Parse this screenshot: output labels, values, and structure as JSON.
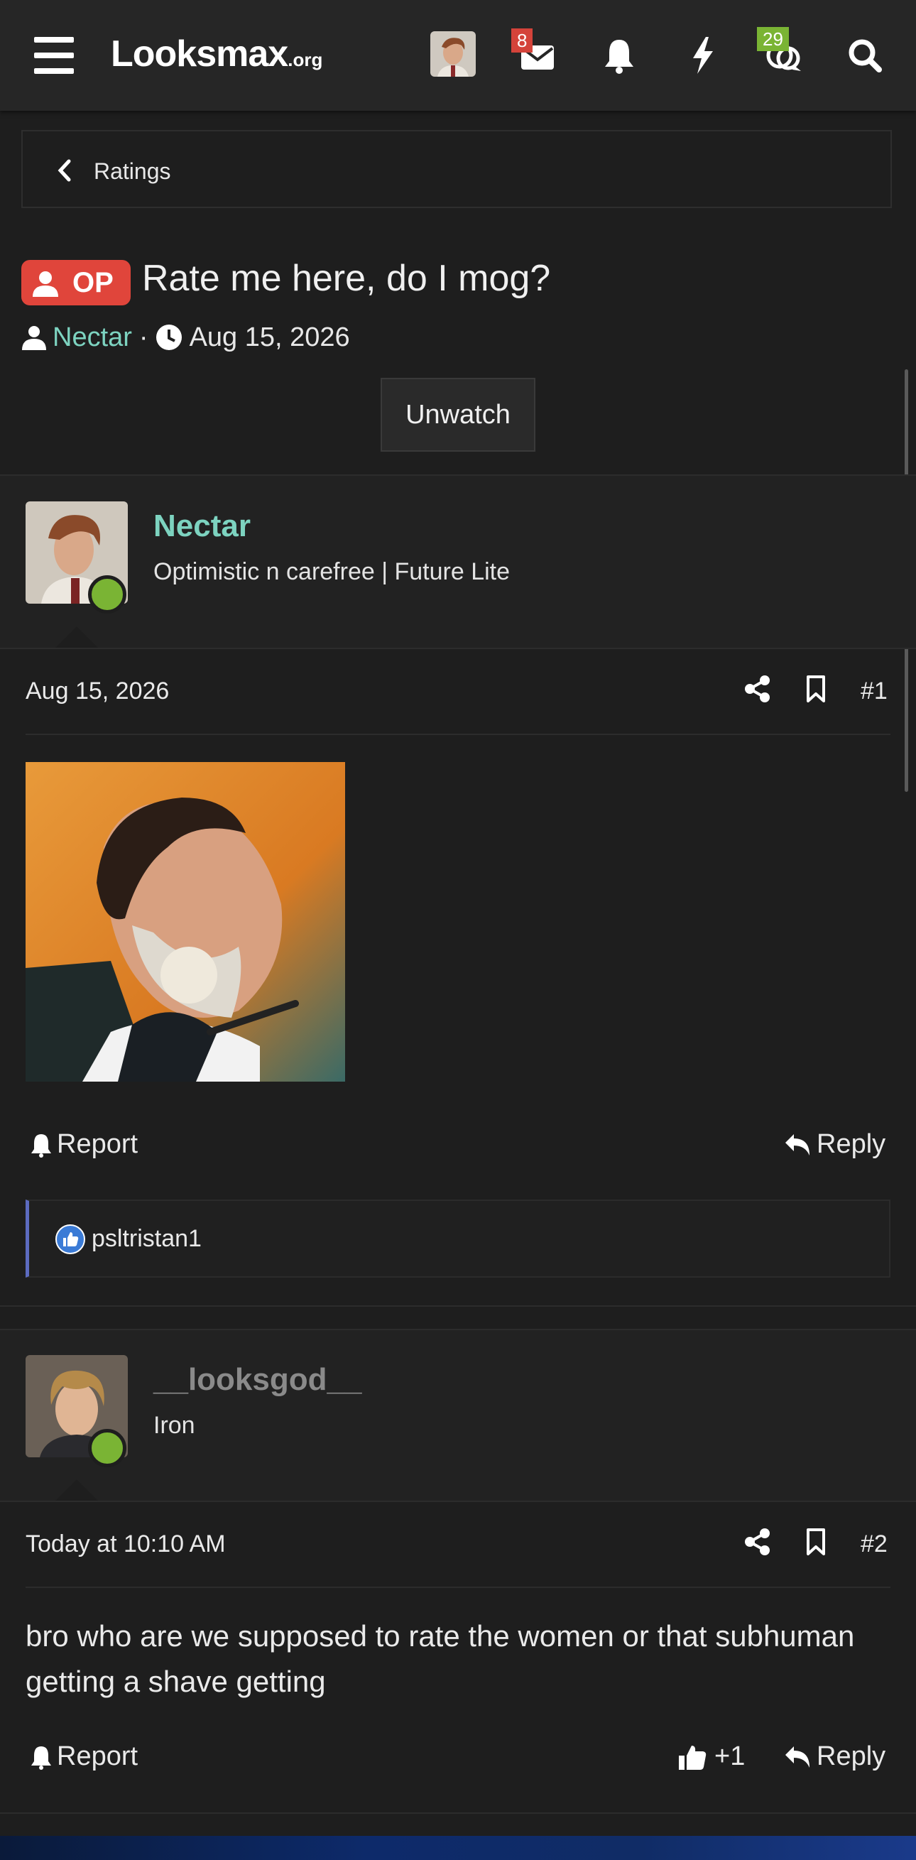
{
  "header": {
    "logo_main": "Looksmax",
    "logo_suffix": ".org",
    "messages_count": "8",
    "chats_count": "29"
  },
  "breadcrumb": {
    "label": "Ratings"
  },
  "thread": {
    "prefix": "OP",
    "title": "Rate me here, do I mog?",
    "author": "Nectar",
    "date": "Aug 15, 2026",
    "watch_button": "Unwatch"
  },
  "posts": [
    {
      "username": "Nectar",
      "user_title": "Optimistic n carefree | Future Lite",
      "date": "Aug 15, 2026",
      "number": "#1",
      "report_label": "Report",
      "reply_label": "Reply",
      "reaction_user": "psltristan1"
    },
    {
      "username": "__looksgod__",
      "user_title": "Iron",
      "date": "Today at 10:10 AM",
      "number": "#2",
      "body": "bro who are we supposed to rate the women or that subhuman getting a shave getting",
      "report_label": "Report",
      "like_count": "+1",
      "reply_label": "Reply"
    }
  ],
  "colors": {
    "accent_teal": "#7dd3c0",
    "op_red": "#e0453b",
    "online_green": "#7ab434",
    "badge_red": "#d4433a"
  }
}
